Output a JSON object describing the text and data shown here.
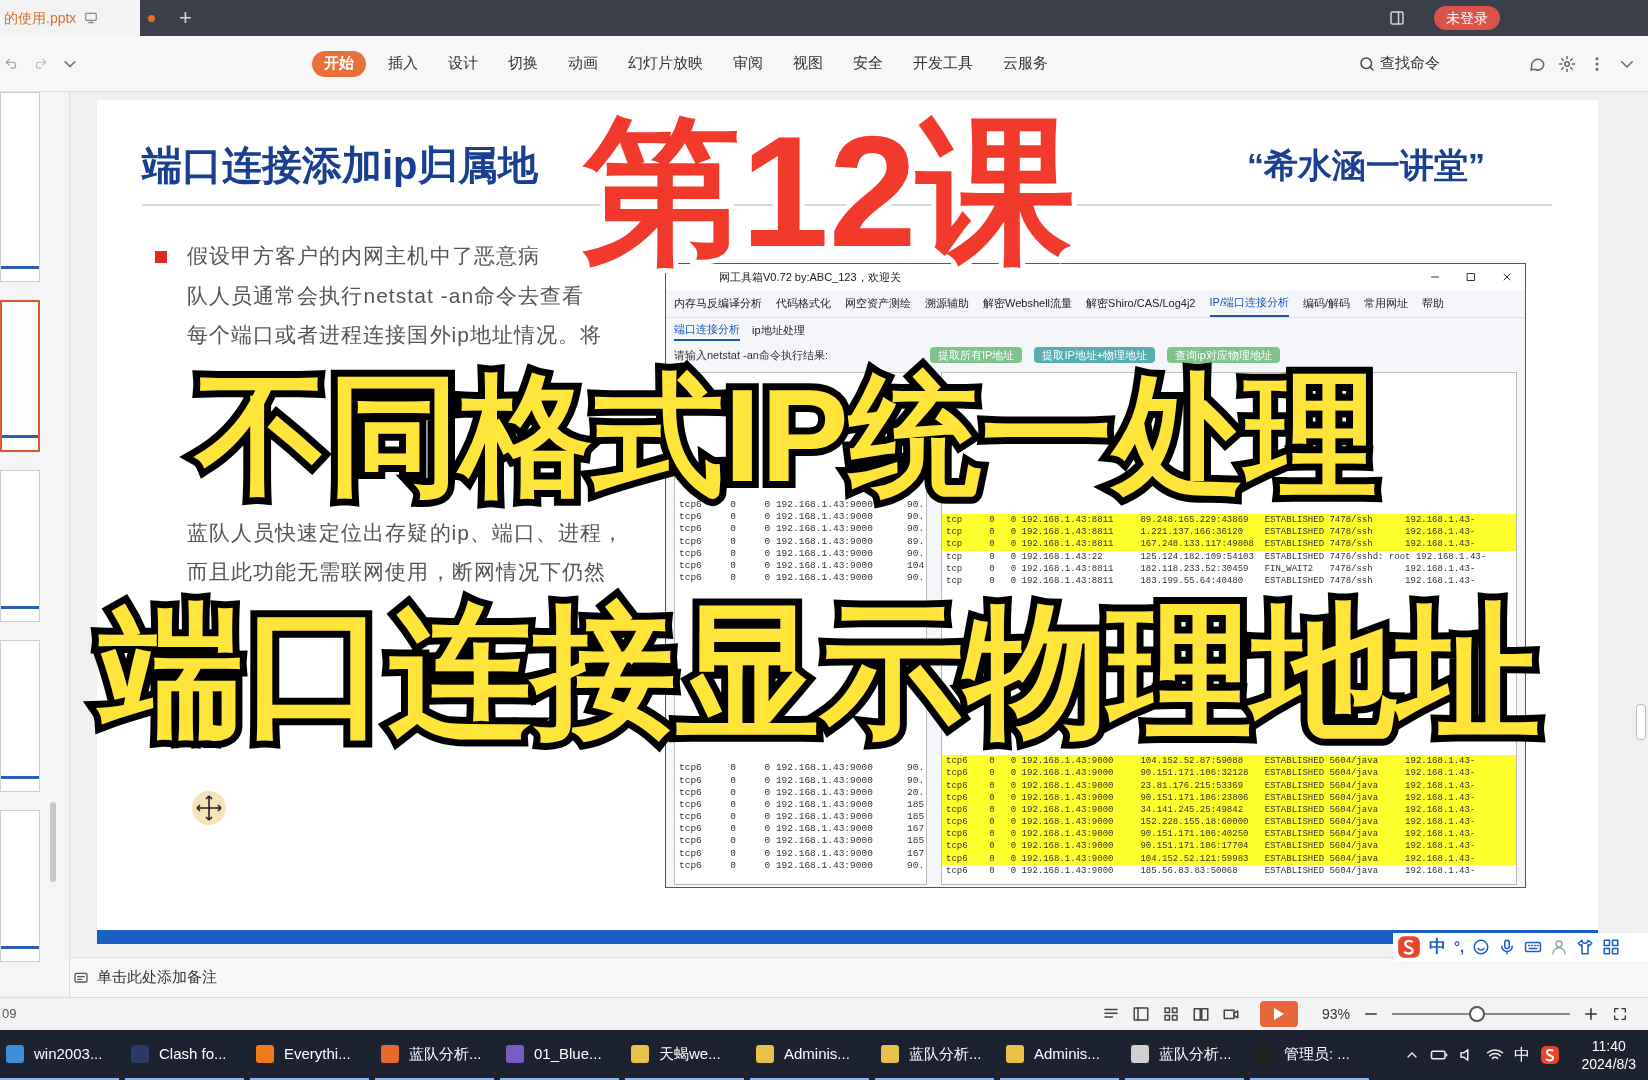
{
  "title_bar": {
    "document_tab": "的使用.pptx",
    "new_tab": "+",
    "login_button": "未登录"
  },
  "ribbon": {
    "tabs": [
      {
        "label": "开始",
        "selected": true
      },
      {
        "label": "插入",
        "selected": false
      },
      {
        "label": "设计",
        "selected": false
      },
      {
        "label": "切换",
        "selected": false
      },
      {
        "label": "动画",
        "selected": false
      },
      {
        "label": "幻灯片放映",
        "selected": false
      },
      {
        "label": "审阅",
        "selected": false
      },
      {
        "label": "视图",
        "selected": false
      },
      {
        "label": "安全",
        "selected": false
      },
      {
        "label": "开发工具",
        "selected": false
      },
      {
        "label": "云服务",
        "selected": false
      }
    ],
    "search": "查找命令"
  },
  "thumbnails": [
    {
      "selected": false
    },
    {
      "selected": true
    },
    {
      "selected": false
    },
    {
      "selected": false
    },
    {
      "selected": false
    }
  ],
  "slide": {
    "title": "端口连接添加ip归属地",
    "brand": "“希水涵一讲堂”",
    "paragraph_lines": [
      "假设甲方客户的内网主机中了恶意病",
      "队人员通常会执行netstat -an命令去查看",
      "每个端口或者进程连接国外ip地址情况。将",
      "蓝队人员快速定位出存疑的ip、端口、进程，",
      "而且此功能无需联网使用，断网情况下仍然"
    ],
    "tool_window": {
      "title": "网工具箱V0.72 by:ABC_123，欢迎关",
      "menu": [
        {
          "label": "内存马反编译分析",
          "selected": false
        },
        {
          "label": "代码格式化",
          "selected": false
        },
        {
          "label": "网空资产测绘",
          "selected": false
        },
        {
          "label": "溯源辅助",
          "selected": false
        },
        {
          "label": "解密Webshell流量",
          "selected": false
        },
        {
          "label": "解密Shiro/CAS/Log4j2",
          "selected": false
        },
        {
          "label": "IP/端口连接分析",
          "selected": true
        },
        {
          "label": "编码/解码",
          "selected": false
        },
        {
          "label": "常用网址",
          "selected": false
        },
        {
          "label": "帮助",
          "selected": false
        }
      ],
      "sub_tabs": [
        {
          "label": "端口连接分析",
          "selected": true
        },
        {
          "label": "ip地址处理",
          "selected": false
        }
      ],
      "input_label": "请输入netstat -an命令执行结果:",
      "buttons": [
        "提取所有IP地址",
        "提取IP地址+物理地址",
        "查询ip对应物理地址"
      ],
      "input_blocks": [
        [
          "tcp6     0     0 192.168.1.43:9000      90.",
          "tcp6     0     0 192.168.1.43:9000      90.",
          "tcp6     0     0 192.168.1.43:9000      90.",
          "tcp6     0     0 192.168.1.43:9000      89.",
          "tcp6     0     0 192.168.1.43:9000      90.",
          "tcp6     0     0 192.168.1.43:9000      104",
          "tcp6     0     0 192.168.1.43:9000      90."
        ],
        [
          "tcp6     0     0 192.168.1.43:9000      90.",
          "tcp6     0     0 192.168.1.43:9000      90.",
          "tcp6     0     0 192.168.1.43:9000      20.",
          "tcp6     0     0 192.168.1.43:9000      185",
          "tcp6     0     0 192.168.1.43:9000      185",
          "tcp6     0     0 192.168.1.43:9000      167",
          "tcp6     0     0 192.168.1.43:9000      185",
          "tcp6     0     0 192.168.1.43:9000      167",
          "tcp6     0     0 192.168.1.43:9000      90."
        ]
      ],
      "result_blocks": [
        [
          {
            "text": "tcp     0   0 192.168.1.43:8811     89.248.165.229:43869   ESTABLISHED 7478/ssh      192.168.1.43-",
            "highlighted": true
          },
          {
            "text": "tcp     0   0 192.168.1.43:8811     1.221.137.166:36120    ESTABLISHED 7478/ssh      192.168.1.43-",
            "highlighted": true
          },
          {
            "text": "tcp     0   0 192.168.1.43:8811     167.248.133.117:49808  ESTABLISHED 7478/ssh      192.168.1.43-",
            "highlighted": true
          },
          {
            "text": "tcp     0   0 192.168.1.43:22       125.124.182.109:54103  ESTABLISHED 7476/sshd: root 192.168.1.43-",
            "highlighted": false
          },
          {
            "text": "tcp     0   0 192.168.1.43:8811     182.118.233.52:30459   FIN_WAIT2   7478/ssh      192.168.1.43-",
            "highlighted": false
          },
          {
            "text": "tcp     0   0 192.168.1.43:8811     183.199.55.64:40480    ESTABLISHED 7478/ssh      192.168.1.43-",
            "highlighted": false
          }
        ],
        [
          {
            "text": "tcp6    0   0 192.168.1.43:9000     104.152.52.87:59088    ESTABLISHED 5604/java     192.168.1.43-",
            "highlighted": true
          },
          {
            "text": "tcp6    0   0 192.168.1.43:9000     90.151.171.106:32128   ESTABLISHED 5604/java     192.168.1.43-",
            "highlighted": true
          },
          {
            "text": "tcp6    0   0 192.168.1.43:9000     23.81.176.215:53369    ESTABLISHED 5604/java     192.168.1.43-",
            "highlighted": true
          },
          {
            "text": "tcp6    0   0 192.168.1.43:9000     90.151.171.106:23806   ESTABLISHED 5604/java     192.168.1.43-",
            "highlighted": true
          },
          {
            "text": "tcp6    0   0 192.168.1.43:9000     34.141.245.25:49842    ESTABLISHED 5604/java     192.168.1.43-",
            "highlighted": true
          },
          {
            "text": "tcp6    0   0 192.168.1.43:9000     152.228.155.18:60000   ESTABLISHED 5604/java     192.168.1.43-",
            "highlighted": true
          },
          {
            "text": "tcp6    0   0 192.168.1.43:9000     90.151.171.106:40250   ESTABLISHED 5604/java     192.168.1.43-",
            "highlighted": true
          },
          {
            "text": "tcp6    0   0 192.168.1.43:9000     90.151.171.106:17704   ESTABLISHED 5604/java     192.168.1.43-",
            "highlighted": true
          },
          {
            "text": "tcp6    0   0 192.168.1.43:9000     104.152.52.121:59983   ESTABLISHED 5604/java     192.168.1.43-",
            "highlighted": true
          },
          {
            "text": "tcp6    0   0 192.168.1.43:9000     185.56.83.83:50068     ESTABLISHED 5604/java     192.168.1.43-",
            "highlighted": false
          }
        ]
      ]
    }
  },
  "overlay_captions": [
    {
      "text": "第12课",
      "kind": "red"
    },
    {
      "text": "不同格式IP统一处理",
      "kind": "yellow"
    },
    {
      "text": "端口连接显示物理地址",
      "kind": "yellow"
    }
  ],
  "notes_placeholder": "单击此处添加备注",
  "ime_toolbar": {
    "mode": "中",
    "punctuation": "°,"
  },
  "status_bar": {
    "page": "09",
    "zoom": "93%",
    "zoom_slider": {
      "level": 0.48
    }
  },
  "taskbar": {
    "items": [
      "win2003...",
      "Clash fo...",
      "Everythi...",
      "蓝队分析...",
      "01_Blue...",
      "天蝎we...",
      "Adminis...",
      "蓝队分析...",
      "Adminis...",
      "蓝队分析...",
      "管理员: ..."
    ],
    "input_mode": "中",
    "time": "11:40",
    "date": "2024/8/3"
  }
}
